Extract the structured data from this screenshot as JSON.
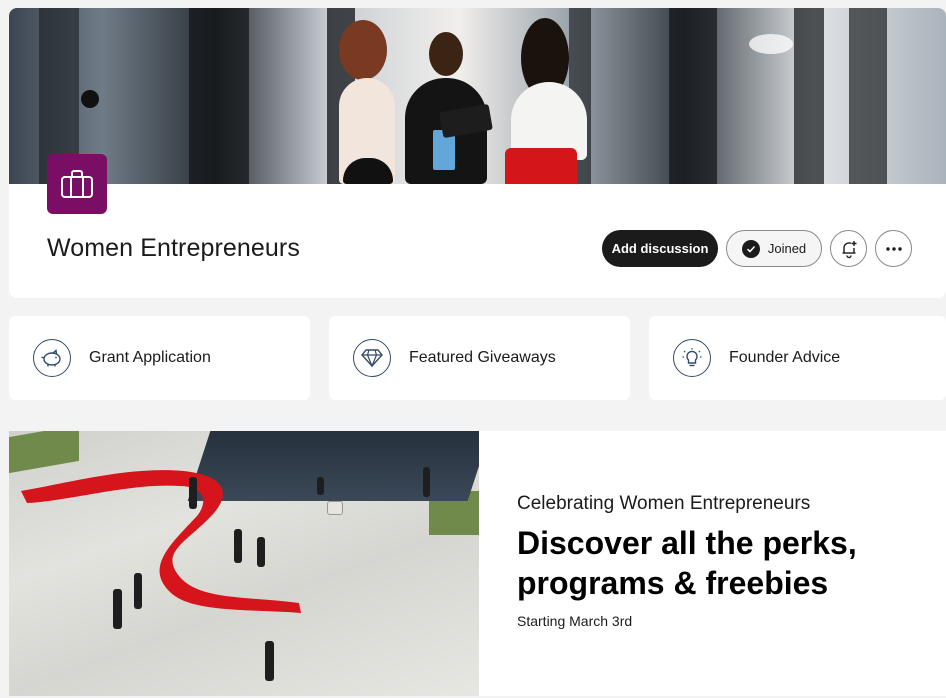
{
  "group": {
    "name": "Women Entrepreneurs",
    "logo_icon": "briefcase-icon",
    "accent": "#7a0e64"
  },
  "actions": {
    "add_discussion": "Add discussion",
    "joined": "Joined",
    "notify_icon": "bell-add-icon",
    "more_icon": "more-horizontal-icon"
  },
  "tiles": [
    {
      "label": "Grant Application",
      "icon": "piggy-bank-icon"
    },
    {
      "label": "Featured Giveaways",
      "icon": "diamond-icon"
    },
    {
      "label": "Founder Advice",
      "icon": "lightbulb-icon"
    }
  ],
  "feature": {
    "eyebrow": "Celebrating Women Entrepreneurs",
    "headline": "Discover all the perks, programs & freebies",
    "subtext": "Starting March 3rd"
  }
}
